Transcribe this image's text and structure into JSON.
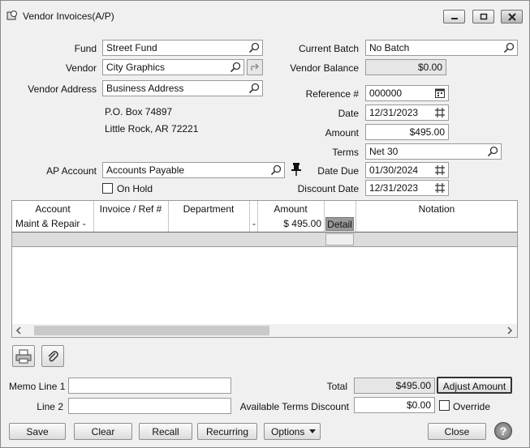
{
  "window": {
    "title": "Vendor Invoices(A/P)"
  },
  "form": {
    "fund": {
      "label": "Fund",
      "value": "Street Fund"
    },
    "vendor": {
      "label": "Vendor",
      "value": "City Graphics"
    },
    "vendor_address": {
      "label": "Vendor Address",
      "value": "Business Address"
    },
    "address_line1": "P.O. Box 74897",
    "address_line2": "Little Rock, AR  72221",
    "current_batch": {
      "label": "Current Batch",
      "value": "No Batch"
    },
    "vendor_balance": {
      "label": "Vendor Balance",
      "value": "$0.00"
    },
    "reference": {
      "label": "Reference #",
      "value": "000000"
    },
    "date": {
      "label": "Date",
      "value": "12/31/2023"
    },
    "amount": {
      "label": "Amount",
      "value": "$495.00"
    },
    "terms": {
      "label": "Terms",
      "value": "Net 30"
    },
    "ap_account": {
      "label": "AP Account",
      "value": "Accounts Payable"
    },
    "on_hold": {
      "label": "On Hold"
    },
    "date_due": {
      "label": "Date Due",
      "value": "01/30/2024"
    },
    "discount_date": {
      "label": "Discount Date",
      "value": "12/31/2023"
    }
  },
  "grid": {
    "columns": [
      "Account",
      "Invoice / Ref #",
      "Department",
      "Amount",
      "Notation"
    ],
    "rows": [
      {
        "account": "Maint & Repair -",
        "invoice": "",
        "department": "",
        "dash": "-",
        "amount": "$ 495.00",
        "detail": "Detail",
        "notation": ""
      }
    ]
  },
  "footer": {
    "memo1_label": "Memo Line 1",
    "memo2_label": "Line 2",
    "memo1_value": "",
    "memo2_value": "",
    "total_label": "Total",
    "total_value": "$495.00",
    "adjust_label": "Adjust Amount",
    "avail_label": "Available Terms Discount",
    "avail_value": "$0.00",
    "override_label": "Override"
  },
  "buttons": {
    "save": "Save",
    "clear": "Clear",
    "recall": "Recall",
    "recurring": "Recurring",
    "options": "Options",
    "close": "Close",
    "help": "?"
  }
}
